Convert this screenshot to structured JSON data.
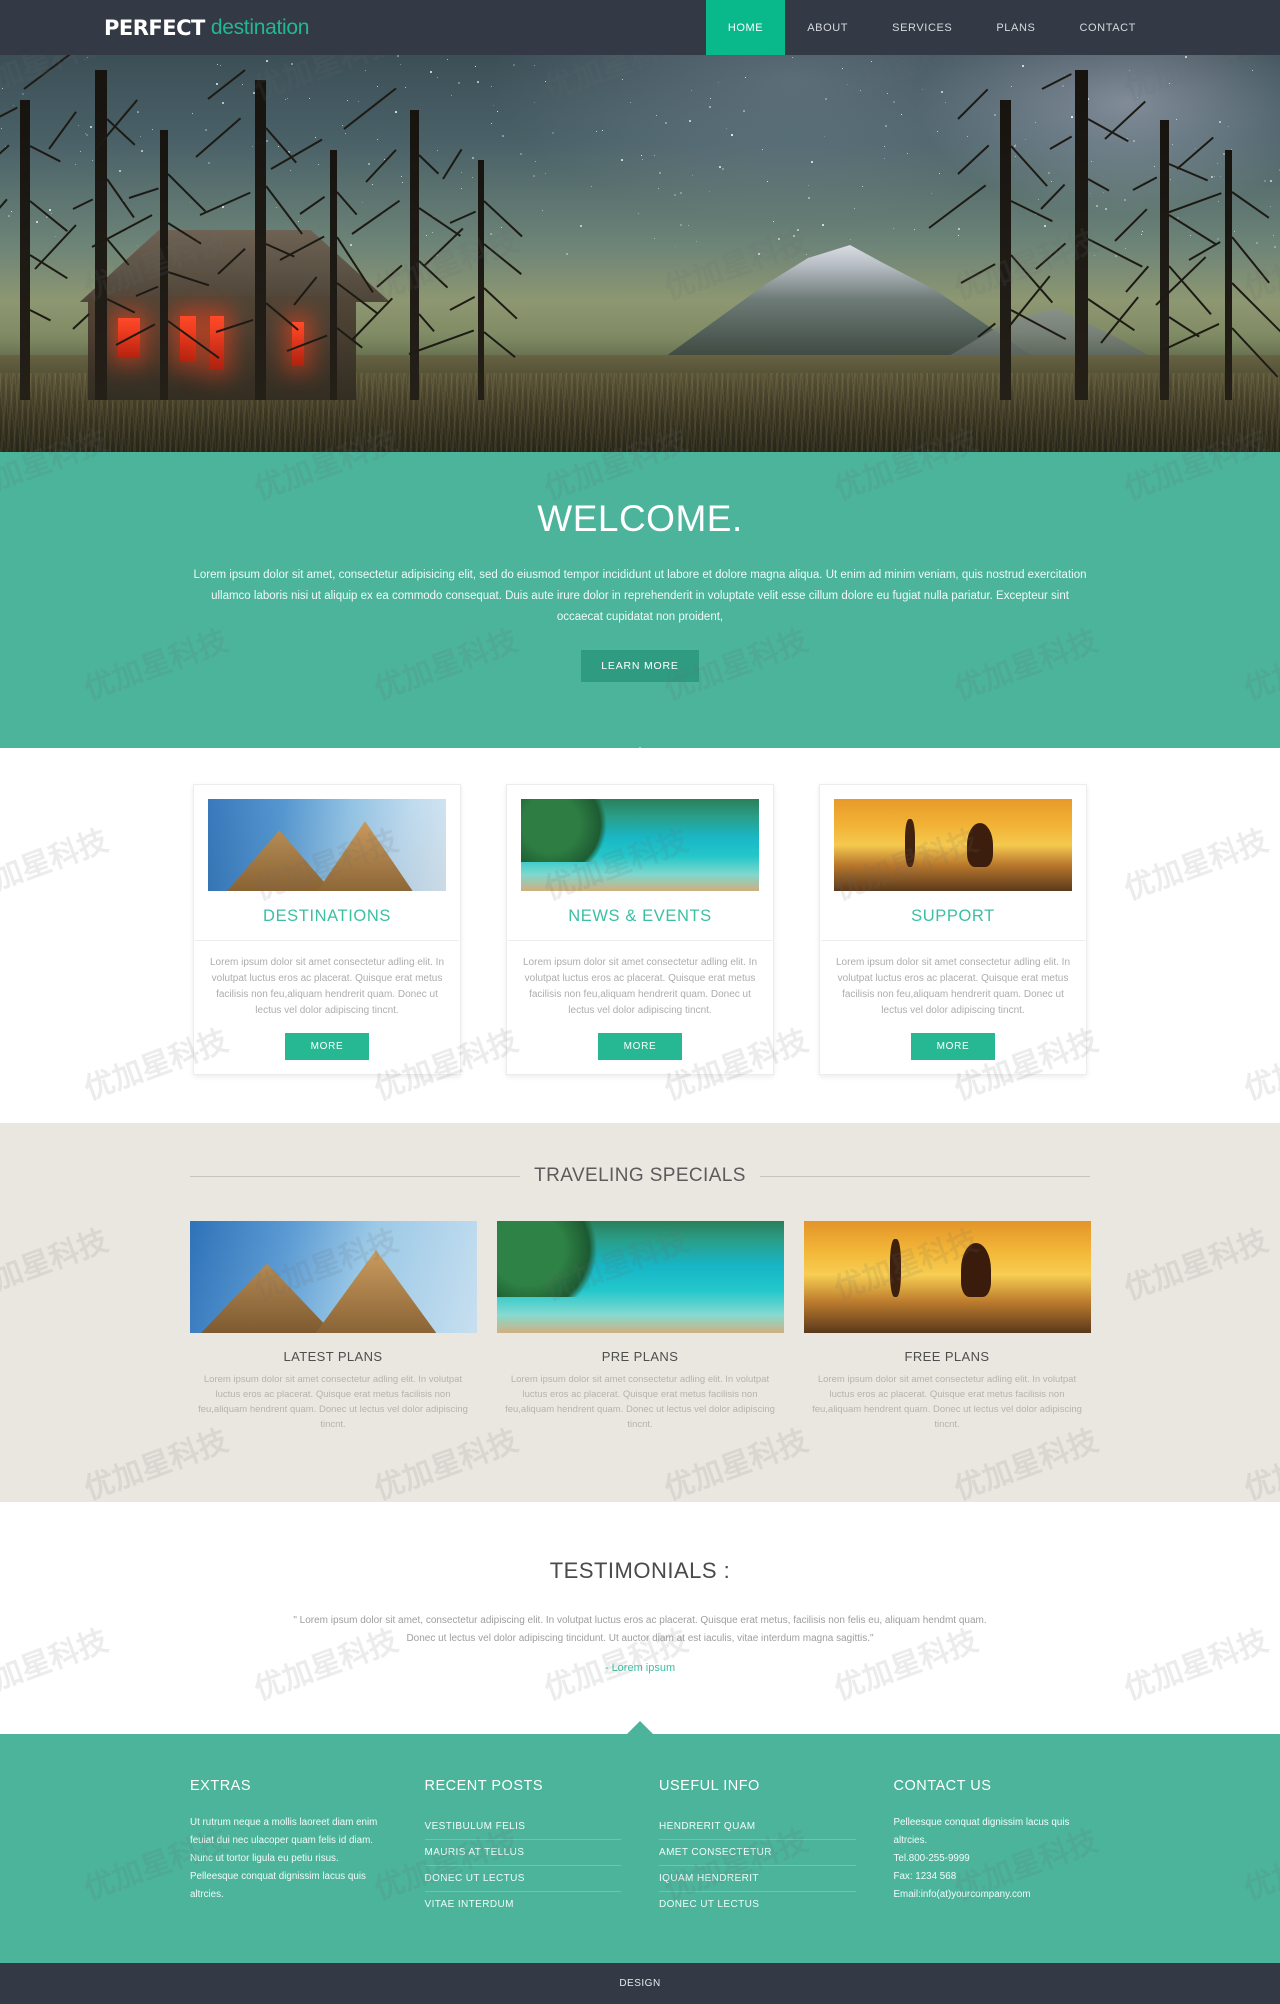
{
  "header": {
    "logo_strong": "PERFECT",
    "logo_light": "destination",
    "nav": [
      {
        "label": "HOME",
        "active": true
      },
      {
        "label": "ABOUT",
        "active": false
      },
      {
        "label": "SERVICES",
        "active": false
      },
      {
        "label": "PLANS",
        "active": false
      },
      {
        "label": "CONTACT",
        "active": false
      }
    ]
  },
  "welcome": {
    "title": "WELCOME.",
    "paragraph": "Lorem ipsum dolor sit amet, consectetur adipisicing elit, sed do eiusmod tempor incididunt ut labore et dolore magna aliqua. Ut enim ad minim veniam, quis nostrud exercitation ullamco laboris nisi ut aliquip ex ea commodo consequat. Duis aute irure dolor in reprehenderit in voluptate velit esse cillum dolore eu fugiat nulla pariatur. Excepteur sint occaecat cupidatat non proident,",
    "button": "LEARN MORE"
  },
  "cards": [
    {
      "title": "DESTINATIONS",
      "text": "Lorem ipsum dolor sit amet consectetur adling elit. In volutpat luctus eros ac placerat. Quisque erat metus facilisis non feu,aliquam hendrerit quam. Donec ut lectus vel dolor adipiscing tincnt.",
      "button": "MORE",
      "image": "pyramids-photo"
    },
    {
      "title": "NEWS & EVENTS",
      "text": "Lorem ipsum dolor sit amet consectetur adling elit. In volutpat luctus eros ac placerat. Quisque erat metus facilisis non feu,aliquam hendrerit quam. Donec ut lectus vel dolor adipiscing tincnt.",
      "button": "MORE",
      "image": "tropical-beach-photo"
    },
    {
      "title": "SUPPORT",
      "text": "Lorem ipsum dolor sit amet consectetur adling elit. In volutpat luctus eros ac placerat. Quisque erat metus facilisis non feu,aliquam hendrerit quam. Donec ut lectus vel dolor adipiscing tincnt.",
      "button": "MORE",
      "image": "couple-sunset-photo"
    }
  ],
  "specials": {
    "heading": "TRAVELING SPECIALS",
    "items": [
      {
        "title": "LATEST PLANS",
        "text": "Lorem ipsum dolor sit amet consectetur adling elit. In volutpat luctus eros ac placerat. Quisque erat metus facilisis non feu,aliquam hendrent quam. Donec ut lectus vel dolor adipiscing tincnt.",
        "image": "pyramids-photo"
      },
      {
        "title": "PRE PLANS",
        "text": "Lorem ipsum dolor sit amet consectetur adling elit. In volutpat luctus eros ac placerat. Quisque erat metus facilisis non feu,aliquam hendrent quam. Donec ut lectus vel dolor adipiscing tincnt.",
        "image": "tropical-beach-photo"
      },
      {
        "title": "FREE PLANS",
        "text": "Lorem ipsum dolor sit amet consectetur adling elit. In volutpat luctus eros ac placerat. Quisque erat metus facilisis non feu,aliquam hendrent quam. Donec ut lectus vel dolor adipiscing tincnt.",
        "image": "couple-sunset-photo"
      }
    ]
  },
  "testimonials": {
    "heading": "TESTIMONIALS :",
    "quote": "\" Lorem ipsum dolor sit amet, consectetur adipiscing elit. In volutpat luctus eros ac placerat. Quisque erat metus, facilisis non felis eu, aliquam hendmt quam. Donec ut lectus vel dolor adipiscing tincidunt. Ut auctor diam at est iaculis, vitae interdum magna sagittis.\"",
    "author": "- Lorem ipsum"
  },
  "footer": {
    "extras": {
      "title": "EXTRAS",
      "text": "Ut rutrum neque a mollis laoreet diam enim feuiat dui nec ulacoper quam felis id diam. Nunc ut tortor ligula eu petiu risus. Pelleesque conquat dignissim lacus quis altrcies."
    },
    "recent_posts": {
      "title": "RECENT POSTS",
      "items": [
        "VESTIBULUM FELIS",
        "MAURIS AT TELLUS",
        "DONEC UT LECTUS",
        "VITAE INTERDUM"
      ]
    },
    "useful_info": {
      "title": "USEFUL INFO",
      "items": [
        "HENDRERIT QUAM",
        "AMET CONSECTETUR",
        "IQUAM HENDRERIT",
        "DONEC UT LECTUS"
      ]
    },
    "contact": {
      "title": "CONTACT US",
      "blurb": "Pelleesque conquat dignissim lacus quis altrcies.",
      "tel": "Tel.800-255-9999",
      "fax": "Fax: 1234 568",
      "email": "Email:info(at)yourcompany.com"
    }
  },
  "bottombar": {
    "text": "DESIGN"
  },
  "watermark": {
    "text": "优加星科技"
  },
  "colors": {
    "header_bg": "#333a45",
    "accent_teal": "#09b98c",
    "welcome_bg": "#4bb49b",
    "card_title": "#3bbfa3",
    "specials_bg": "#eae7e1",
    "button_green": "#26b793"
  }
}
